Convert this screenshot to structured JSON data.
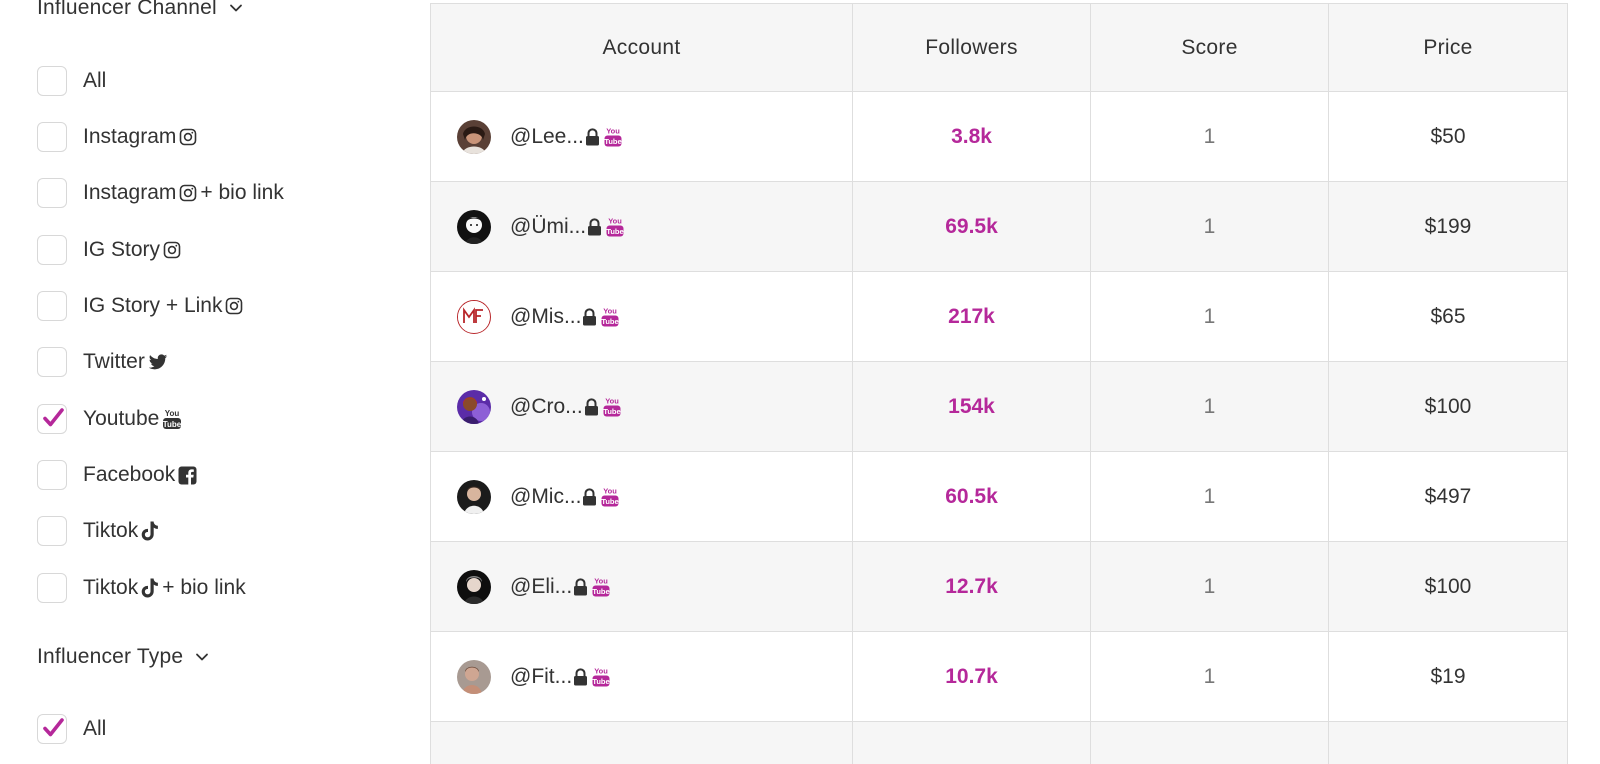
{
  "sidebar": {
    "channel_title": "Influencer Channel",
    "channel_options": [
      {
        "label": "All",
        "suffix": "",
        "checked": false,
        "icon": ""
      },
      {
        "label": "Instagram",
        "suffix": "",
        "checked": false,
        "icon": "instagram-icon"
      },
      {
        "label": "Instagram",
        "suffix": "+ bio link",
        "checked": false,
        "icon": "instagram-icon"
      },
      {
        "label": "IG Story",
        "suffix": "",
        "checked": false,
        "icon": "instagram-icon"
      },
      {
        "label": "IG Story + Link",
        "suffix": "",
        "checked": false,
        "icon": "instagram-icon"
      },
      {
        "label": "Twitter",
        "suffix": "",
        "checked": false,
        "icon": "twitter-icon"
      },
      {
        "label": "Youtube",
        "suffix": "",
        "checked": true,
        "icon": "youtube-icon"
      },
      {
        "label": "Facebook",
        "suffix": "",
        "checked": false,
        "icon": "facebook-icon"
      },
      {
        "label": "Tiktok",
        "suffix": "",
        "checked": false,
        "icon": "tiktok-icon"
      },
      {
        "label": "Tiktok",
        "suffix": "+ bio link",
        "checked": false,
        "icon": "tiktok-icon"
      }
    ],
    "type_title": "Influencer Type",
    "type_options": [
      {
        "label": "All",
        "checked": true
      }
    ]
  },
  "table": {
    "headers": [
      "Account",
      "Followers",
      "Score",
      "Price"
    ],
    "rows": [
      {
        "handle": "@Lee...",
        "followers": "3.8k",
        "score": "1",
        "price": "$50"
      },
      {
        "handle": "@Ümi...",
        "followers": "69.5k",
        "score": "1",
        "price": "$199"
      },
      {
        "handle": "@Mis...",
        "followers": "217k",
        "score": "1",
        "price": "$65"
      },
      {
        "handle": "@Cro...",
        "followers": "154k",
        "score": "1",
        "price": "$100"
      },
      {
        "handle": "@Mic...",
        "followers": "60.5k",
        "score": "1",
        "price": "$497"
      },
      {
        "handle": "@Eli...",
        "followers": "12.7k",
        "score": "1",
        "price": "$100"
      },
      {
        "handle": "@Fit...",
        "followers": "10.7k",
        "score": "1",
        "price": "$19"
      }
    ]
  },
  "colors": {
    "accent": "#b5289a",
    "header_bg": "#f6f6f6",
    "stripe_bg": "#f6f6f6",
    "border": "#dedede"
  }
}
